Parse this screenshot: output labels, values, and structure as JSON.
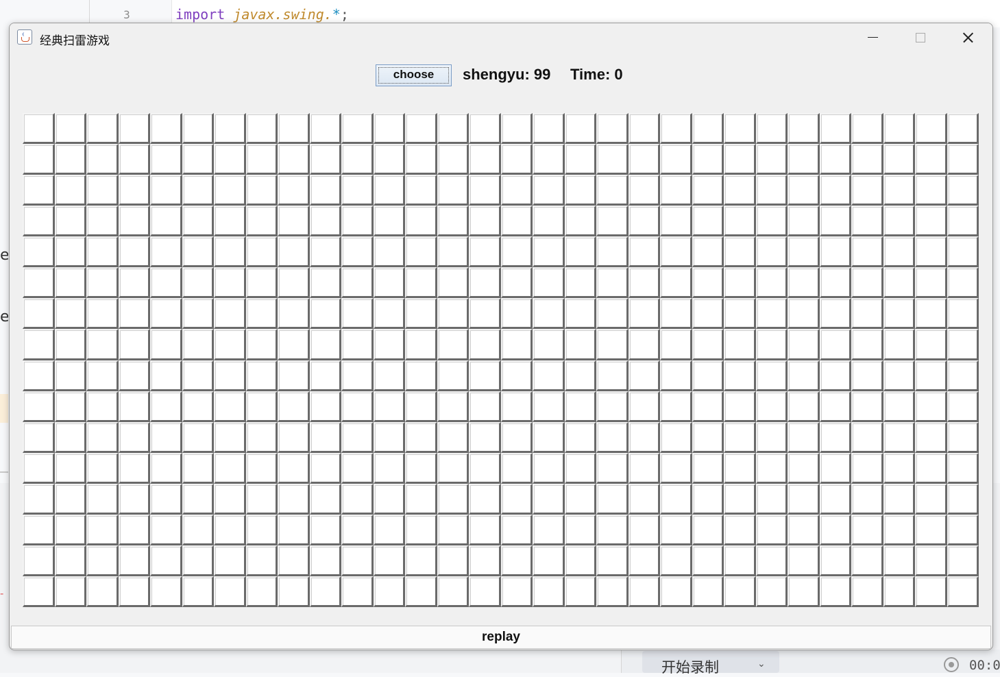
{
  "ide": {
    "line_number": "3",
    "code_keyword": "import",
    "code_package": "javax.swing.",
    "code_star": "*",
    "code_semicolon": ";",
    "side_fragment_1": "ec",
    "side_fragment_2": "er",
    "record_label": "开始录制",
    "record_time": "00:0"
  },
  "window": {
    "title": "经典扫雷游戏",
    "app_icon": "java-icon",
    "controls": [
      "minimize-icon",
      "maximize-icon",
      "close-icon"
    ]
  },
  "toolbar": {
    "choose_label": "choose",
    "remaining_text": "shengyu: 99",
    "time_text": "Time: 0"
  },
  "board": {
    "rows": 16,
    "cols": 30,
    "cell_state": "unrevealed"
  },
  "footer": {
    "replay_label": "replay"
  }
}
